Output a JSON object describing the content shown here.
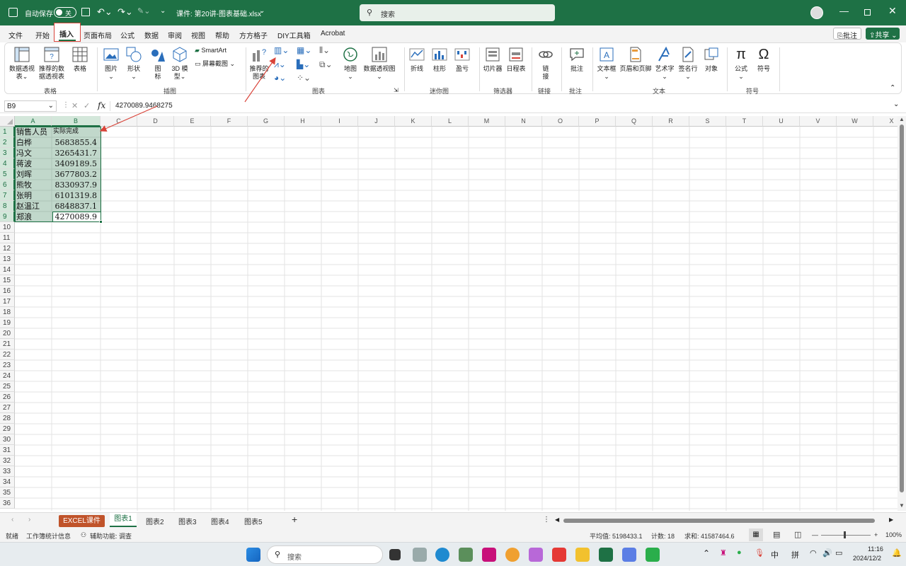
{
  "titlebar": {
    "autosave_label": "自动保存",
    "autosave_state": "关",
    "filename": "课件: 第20讲-图表基础.xlsx",
    "search_placeholder": "搜索"
  },
  "menu": [
    "文件",
    "开始",
    "插入",
    "页面布局",
    "公式",
    "数据",
    "审阅",
    "视图",
    "帮助",
    "方方格子",
    "DIY工具箱",
    "Acrobat"
  ],
  "menu_active": "插入",
  "comment_button": "批注",
  "share_button": "共享",
  "ribbon": {
    "btn_pivot": "数据透视表",
    "btn_rec_pivot": "推荐的数据透视表",
    "btn_table": "表格",
    "btn_picture": "图片",
    "btn_shapes": "形状",
    "btn_icons": "图标",
    "btn_3d": "3D 模型",
    "btn_smartart": "SmartArt",
    "btn_screenshot": "屏幕截图",
    "btn_rec_chart": "推荐的图表",
    "btn_map": "地图",
    "btn_pivotchart": "数据透视图",
    "btn_line": "折线",
    "btn_column": "柱形",
    "btn_winloss": "盈亏",
    "btn_slicer": "切片器",
    "btn_timeline": "日程表",
    "btn_link": "链接",
    "btn_comment": "批注",
    "btn_textbox": "文本框",
    "btn_headerfooter": "页眉和页脚",
    "btn_wordart": "艺术字",
    "btn_signature": "签名行",
    "btn_object": "对象",
    "btn_equation": "公式",
    "btn_symbol": "符号",
    "group_tables": "表格",
    "group_illustrations": "插图",
    "group_charts": "图表",
    "group_sparklines": "迷你图",
    "group_filters": "筛选器",
    "group_links": "链接",
    "group_comments": "批注",
    "group_text": "文本",
    "group_symbols": "符号"
  },
  "formula_bar": {
    "namebox": "B9",
    "fx": "fx",
    "value": "4270089.9468275"
  },
  "columns": [
    "A",
    "B",
    "C",
    "D",
    "E",
    "F",
    "G",
    "H",
    "I",
    "J",
    "K",
    "L",
    "M",
    "N",
    "O",
    "P",
    "Q",
    "R",
    "S",
    "T",
    "U",
    "V",
    "W",
    "X"
  ],
  "rows": [
    "1",
    "2",
    "3",
    "4",
    "5",
    "6",
    "7",
    "8",
    "9",
    "10",
    "11",
    "12",
    "13",
    "14",
    "15",
    "16",
    "17",
    "18",
    "19",
    "20",
    "21",
    "22",
    "23",
    "24",
    "25",
    "26",
    "27",
    "28",
    "29",
    "30",
    "31",
    "32",
    "33",
    "34",
    "35",
    "36"
  ],
  "table": {
    "header": [
      "销售人员",
      "实际完成"
    ],
    "rows": [
      [
        "白桦",
        "5683855.4"
      ],
      [
        "冯文",
        "3265431.7"
      ],
      [
        "蒋波",
        "3409189.5"
      ],
      [
        "刘晖",
        "3677803.2"
      ],
      [
        "熊牧",
        "8330937.9"
      ],
      [
        "张明",
        "6101319.8"
      ],
      [
        "赵温江",
        "6848837.1"
      ],
      [
        "郑浪",
        "4270089.9"
      ]
    ]
  },
  "sheet_tabs": [
    "EXCEL课件",
    "图表1",
    "图表2",
    "图表3",
    "图表4",
    "图表5"
  ],
  "active_sheet": "图表1",
  "status": {
    "ready": "就绪",
    "workbook_stats": "工作簿统计信息",
    "accessibility": "辅助功能: 调查",
    "average": "平均值: 5198433.1",
    "count": "计数: 18",
    "sum": "求和: 41587464.6",
    "zoom": "100%"
  },
  "taskbar": {
    "search": "搜索",
    "ime1": "中",
    "ime2": "拼",
    "time": "11:16",
    "date": "2024/12/2"
  },
  "colors": {
    "excel_green": "#1e7145",
    "annotation_red": "#d9443a"
  }
}
